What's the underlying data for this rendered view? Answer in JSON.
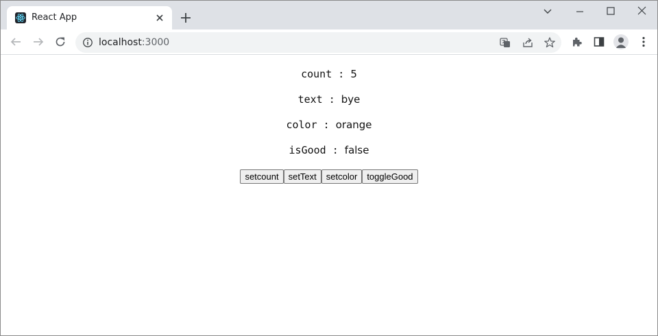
{
  "browser": {
    "tab_title": "React App",
    "url_host": "localhost",
    "url_port": ":3000"
  },
  "page": {
    "lines": [
      {
        "key": "count : ",
        "value": "5"
      },
      {
        "key": "text : ",
        "value": "bye"
      },
      {
        "key": "color : ",
        "value": "orange"
      },
      {
        "key": "isGood : ",
        "value": "false"
      }
    ],
    "buttons": [
      "setcount",
      "setText",
      "setcolor",
      "toggleGood"
    ]
  },
  "colors": {
    "tabstrip_bg": "#dee1e6",
    "omnibox_bg": "#f1f3f4",
    "react_logo": "#61dafb"
  }
}
